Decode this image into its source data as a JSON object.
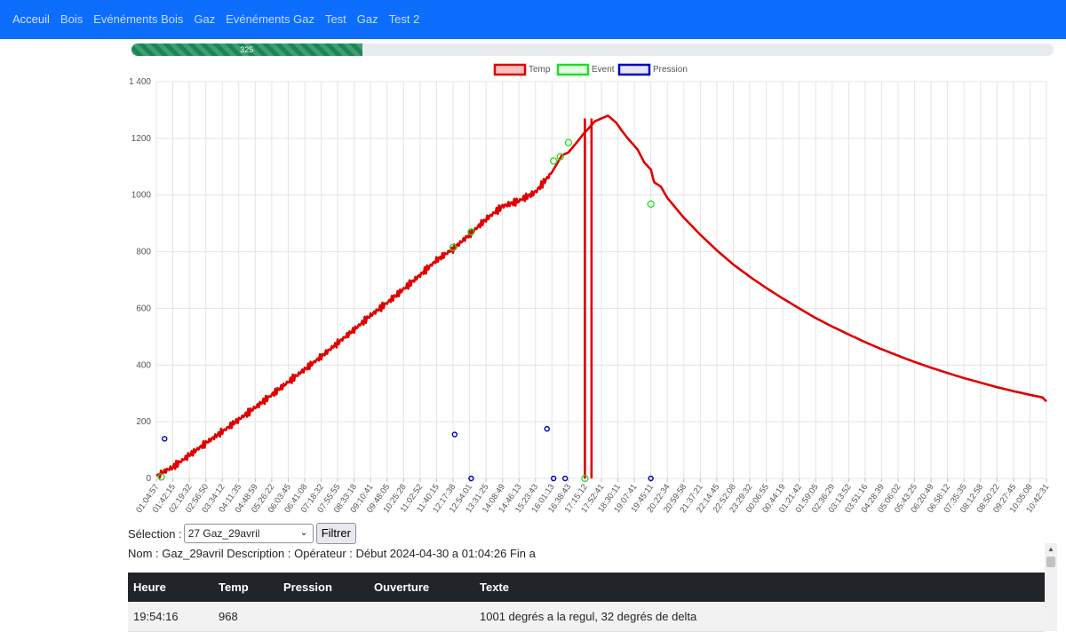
{
  "nav": {
    "items": [
      "Acceuil",
      "Bois",
      "Evénéments Bois",
      "Gaz",
      "Evénéments Gaz",
      "Test",
      "Gaz",
      "Test 2"
    ]
  },
  "progress": {
    "value": 325,
    "fraction": 0.25,
    "label": "325"
  },
  "chart_data": {
    "type": "line",
    "ylim": [
      0,
      1400
    ],
    "yticks": [
      0,
      200,
      400,
      600,
      800,
      1000,
      1200,
      1400
    ],
    "ytick_labels": [
      "0",
      "200",
      "400",
      "600",
      "800",
      "1000",
      "1200",
      "1 400"
    ],
    "legend": [
      {
        "name": "Temp",
        "color": "#e00000"
      },
      {
        "name": "Event",
        "color": "#22dd22"
      },
      {
        "name": "Pression",
        "color": "#0000bb"
      }
    ],
    "legend_position": "top",
    "grid": true,
    "x_labels": [
      "01:04:57",
      "01:42:15",
      "02:19:32",
      "02:56:50",
      "03:34:12",
      "04:11:35",
      "04:48:59",
      "05:26:22",
      "06:03:45",
      "06:41:08",
      "07:18:32",
      "07:55:55",
      "08:33:18",
      "09:10:41",
      "09:48:05",
      "10:25:28",
      "11:02:52",
      "11:40:15",
      "12:17:38",
      "12:54:01",
      "13:31:25",
      "14:08:49",
      "14:46:13",
      "15:23:43",
      "16:01:13",
      "16:38:43",
      "17:15:12",
      "17:52:41",
      "18:30:11",
      "19:07:41",
      "19:45:11",
      "20:22:34",
      "20:59:58",
      "21:37:21",
      "22:14:45",
      "22:52:08",
      "23:29:32",
      "00:06:55",
      "00:44:19",
      "01:21:42",
      "01:59:05",
      "02:36:29",
      "03:13:52",
      "03:51:16",
      "04:28:39",
      "05:06:02",
      "05:43:25",
      "06:20:49",
      "06:58:12",
      "07:35:35",
      "08:12:58",
      "08:50:22",
      "09:27:45",
      "10:05:08",
      "10:42:31"
    ],
    "temp": {
      "name": "Temp",
      "x": [
        0,
        1,
        2,
        3,
        4,
        5,
        6,
        7,
        8,
        9,
        10,
        11,
        12,
        13,
        14,
        15,
        16,
        17,
        18,
        19,
        20,
        21,
        22,
        23,
        24,
        24.4,
        24.6,
        25,
        25.5,
        25.9,
        26.3,
        26.6,
        27.0,
        27.2,
        27.4,
        27.6,
        27.9,
        28.2,
        28.6,
        29.2,
        29.6,
        30.0,
        30.2,
        30.6,
        31,
        32,
        33,
        34,
        35,
        36,
        37,
        38,
        39,
        40,
        41,
        42,
        43,
        44,
        45,
        46,
        47,
        48,
        49,
        50,
        51,
        52,
        53,
        54
      ],
      "y": [
        10,
        40,
        82,
        125,
        165,
        208,
        250,
        295,
        340,
        385,
        430,
        478,
        525,
        575,
        620,
        668,
        718,
        770,
        810,
        860,
        915,
        960,
        980,
        1010,
        1080,
        1120,
        1140,
        1150,
        1185,
        1215,
        1240,
        1260,
        1270,
        1275,
        1280,
        1270,
        1255,
        1230,
        1200,
        1160,
        1115,
        1090,
        1045,
        1030,
        990,
        920,
        860,
        805,
        755,
        712,
        672,
        635,
        600,
        566,
        536,
        508,
        481,
        456,
        433,
        411,
        391,
        372,
        354,
        338,
        322,
        308,
        295,
        283,
        272
      ]
    },
    "temp_drop_x": [
      26.0,
      26.4
    ],
    "events": {
      "name": "Event",
      "x": [
        0.3,
        18.0,
        19.1,
        24.1,
        24.5,
        25.0,
        26.0,
        30.0
      ],
      "y": [
        5,
        815,
        870,
        1120,
        1135,
        1185,
        0,
        968
      ]
    },
    "pression": {
      "name": "Pression",
      "x": [
        0.5,
        18.1,
        19.1,
        23.7,
        24.1,
        24.8,
        30.0
      ],
      "y": [
        140,
        155,
        0,
        175,
        0,
        0,
        0
      ]
    }
  },
  "selection": {
    "label": "Sélection :",
    "value": "27 Gaz_29avril",
    "button": "Filtrer"
  },
  "info": {
    "text": "Nom : Gaz_29avril Description : Opérateur : Début 2024-04-30 a 01:04:26 Fin a"
  },
  "table": {
    "headers": [
      "Heure",
      "Temp",
      "Pression",
      "Ouverture",
      "Texte"
    ],
    "rows": [
      [
        "19:54:16",
        "968",
        "",
        "",
        "1001 degrés a la regul, 32 degrés de delta"
      ]
    ]
  }
}
